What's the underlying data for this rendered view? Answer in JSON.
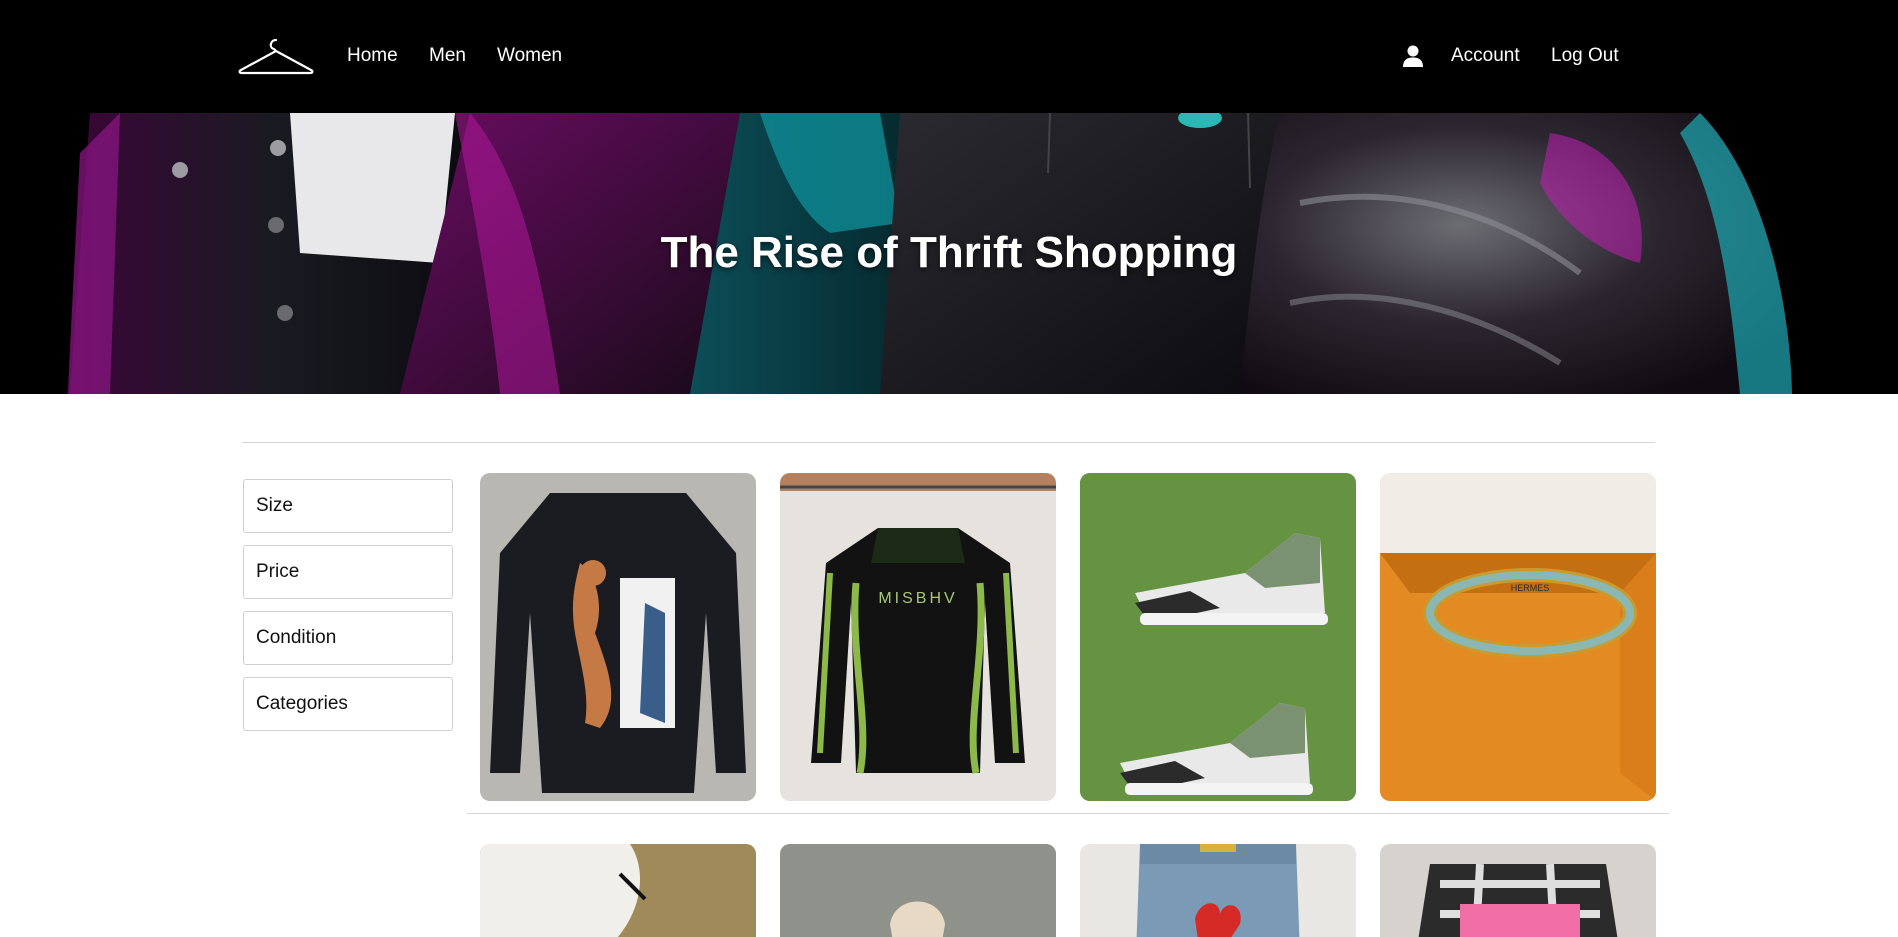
{
  "nav": {
    "links": [
      {
        "label": "Home"
      },
      {
        "label": "Men"
      },
      {
        "label": "Women"
      }
    ],
    "account_label": "Account",
    "logout_label": "Log Out"
  },
  "hero": {
    "title": "The Rise of Thrift Shopping"
  },
  "filters": [
    {
      "label": "Size"
    },
    {
      "label": "Price"
    },
    {
      "label": "Condition"
    },
    {
      "label": "Categories"
    }
  ],
  "products": [
    {
      "image": "black-sweatshirt-bambi-print"
    },
    {
      "image": "misbhv-black-green-top",
      "text": "MISBHV"
    },
    {
      "image": "green-grey-high-top-sneakers"
    },
    {
      "image": "hermes-enamel-bangle-orange-box",
      "text": "HERMES"
    },
    {
      "image": "white-bag-on-straw"
    },
    {
      "image": "item-on-concrete"
    },
    {
      "image": "denim-jeans-red-print"
    },
    {
      "image": "plaid-shirt-pink-print"
    }
  ],
  "colors": {
    "nav_bg": "#000000",
    "accent_magenta": "#b3179d",
    "accent_teal": "#0f8c96"
  }
}
